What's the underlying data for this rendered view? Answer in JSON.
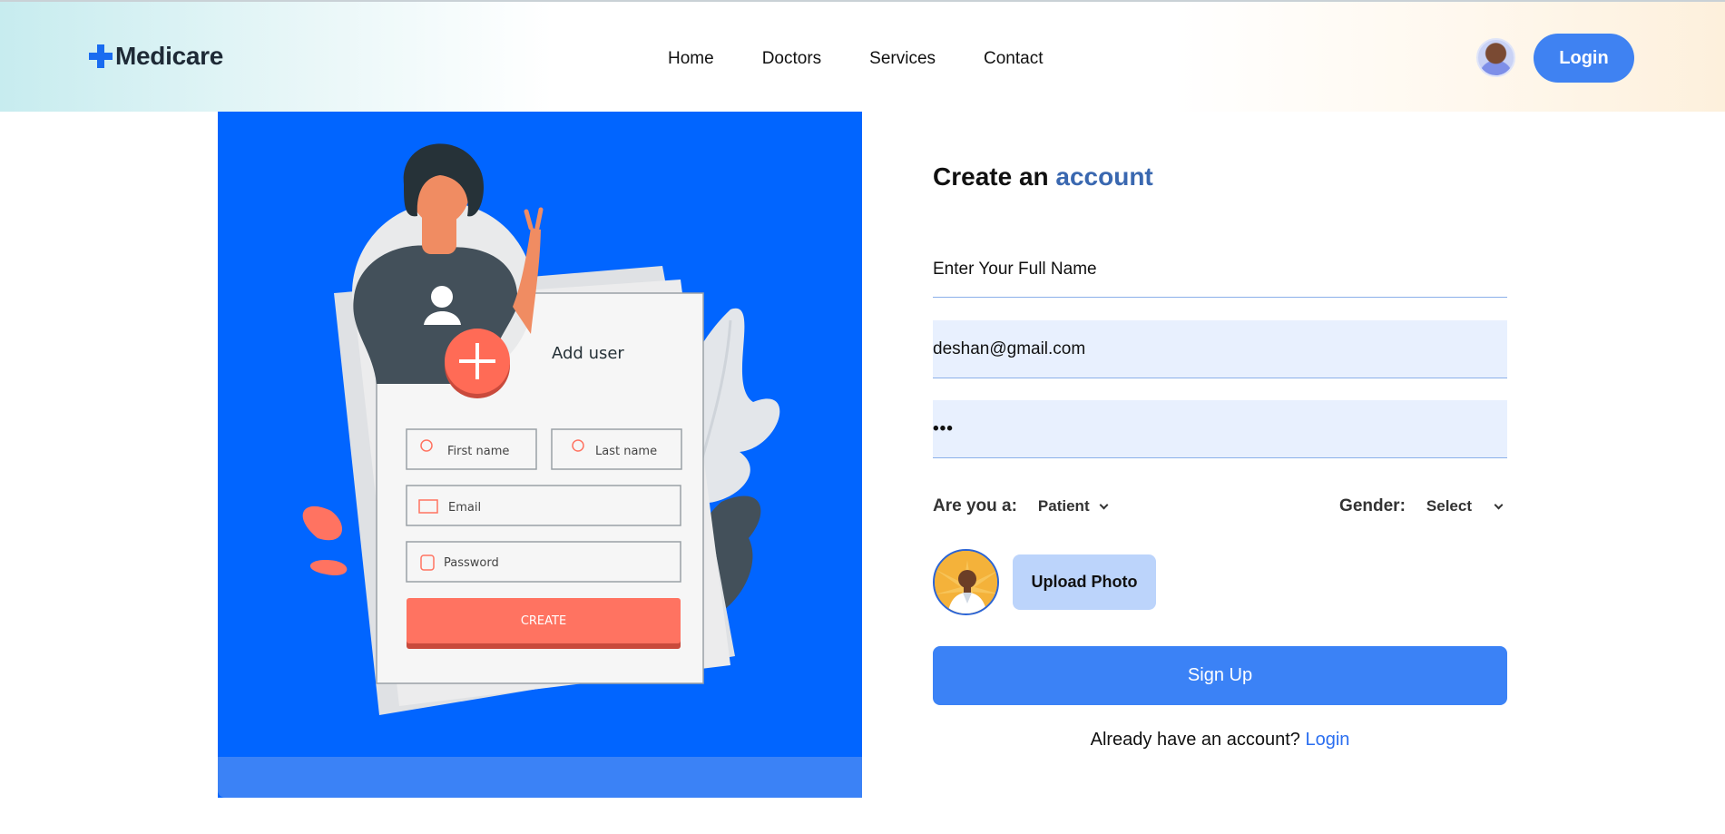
{
  "brand": {
    "name": "Medicare"
  },
  "nav": {
    "items": [
      {
        "label": "Home"
      },
      {
        "label": "Doctors"
      },
      {
        "label": "Services"
      },
      {
        "label": "Contact"
      }
    ]
  },
  "header": {
    "login_label": "Login"
  },
  "illustration": {
    "card_title": "Add user",
    "first_name_placeholder": "First name",
    "last_name_placeholder": "Last name",
    "email_placeholder": "Email",
    "password_placeholder": "Password",
    "create_label": "CREATE"
  },
  "form": {
    "title_prefix": "Create an",
    "title_accent": "account",
    "name_placeholder": "Enter Your Full Name",
    "email_value": "deshan@gmail.com",
    "password_value": "•••",
    "role_label": "Are you a:",
    "role_value": "Patient",
    "gender_label": "Gender:",
    "gender_value": "Select",
    "upload_label": "Upload Photo",
    "signup_label": "Sign Up",
    "already_text": "Already have an account?",
    "login_link": "Login"
  },
  "colors": {
    "brand_blue": "#1a6cf0",
    "panel_blue": "#0165ff",
    "button_blue": "#3b82f6",
    "accent_text": "#3a68b0",
    "input_fill": "#e8f0fe",
    "coral": "#ff7361"
  },
  "icons": {
    "logo": "plus-cross-icon",
    "chevron": "chevron-down-icon"
  }
}
